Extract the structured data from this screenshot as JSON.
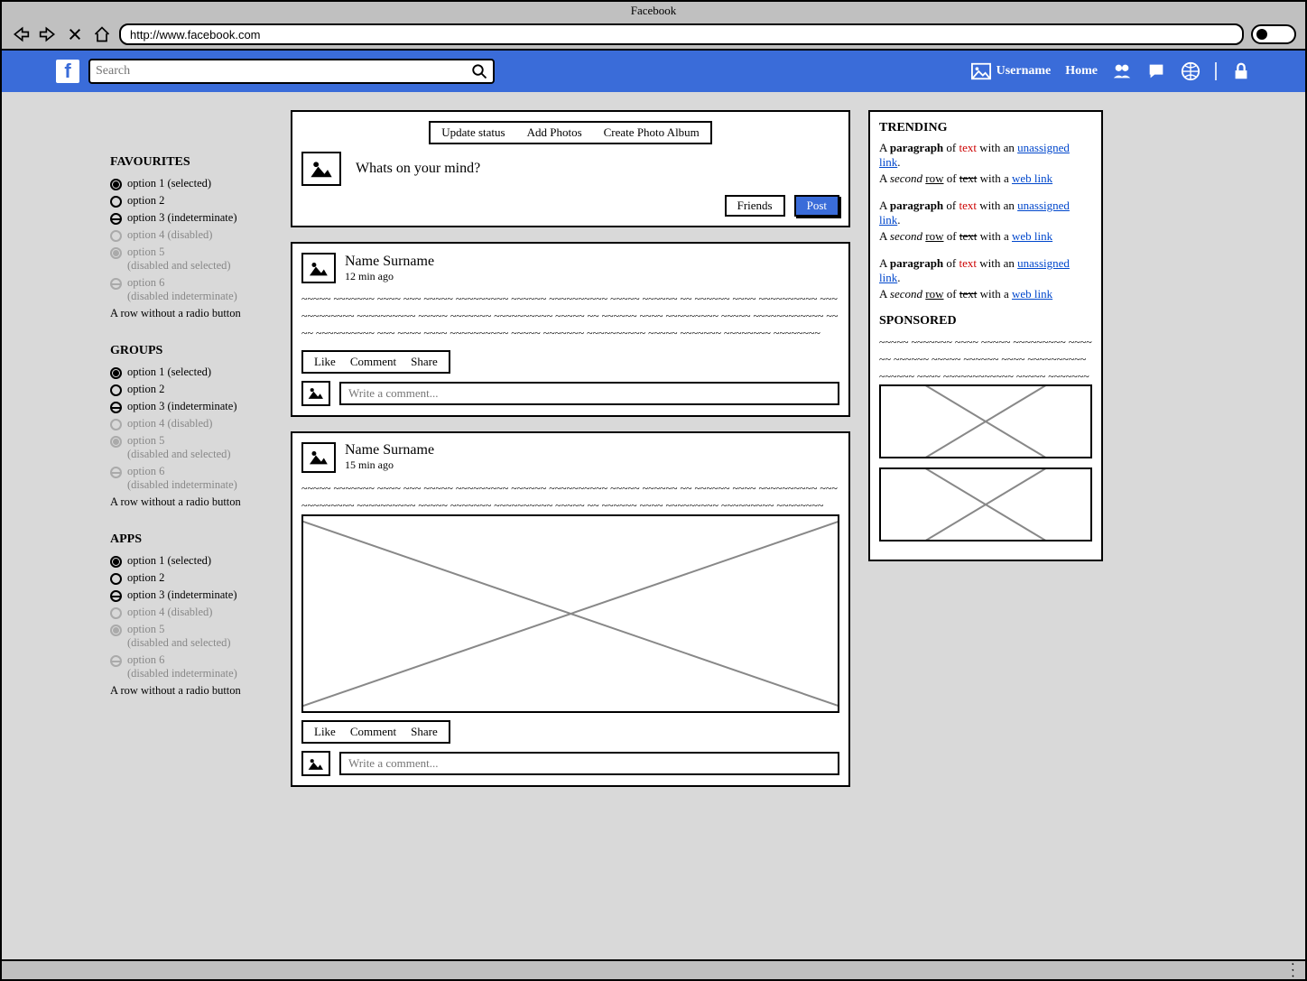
{
  "window": {
    "title": "Facebook",
    "url": "http://www.facebook.com"
  },
  "header": {
    "search_placeholder": "Search",
    "username": "Username",
    "home": "Home"
  },
  "sidebar": {
    "sections": [
      {
        "title": "FAVOURITES"
      },
      {
        "title": "GROUPS"
      },
      {
        "title": "APPS"
      }
    ],
    "options": {
      "o1": "option 1 (selected)",
      "o2": "option 2",
      "o3": "option 3 (indeterminate)",
      "o4": "option 4 (disabled)",
      "o5a": "option 5",
      "o5b": "(disabled and selected)",
      "o6a": "option 6",
      "o6b": "(disabled indeterminate)",
      "norow": "A row without a radio button"
    }
  },
  "composer": {
    "tabs": {
      "update": "Update status",
      "photos": "Add Photos",
      "album": "Create Photo Album"
    },
    "prompt": "Whats on your mind?",
    "friends_btn": "Friends",
    "post_btn": "Post"
  },
  "post_actions": {
    "like": "Like",
    "comment": "Comment",
    "share": "Share"
  },
  "comment_placeholder": "Write a comment...",
  "posts": [
    {
      "name": "Name Surname",
      "time": "12 min ago"
    },
    {
      "name": "Name Surname",
      "time": "15 min ago"
    }
  ],
  "right": {
    "trending_title": "TRENDING",
    "sponsored_title": "SPONSORED",
    "para": {
      "p1a": "A ",
      "p1b": "paragraph",
      "p1c": " of ",
      "p1d": "text",
      "p1e": " with an ",
      "p1f": "unassigned link",
      "p1g": ".",
      "p2a": "A ",
      "p2b": "second",
      "p2c": " ",
      "p2d": "row",
      "p2e": " of ",
      "p2f": "text",
      "p2g": " with a ",
      "p2h": "web link"
    }
  }
}
